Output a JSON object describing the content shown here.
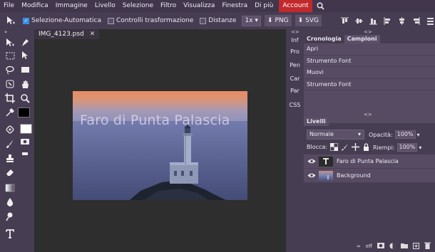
{
  "menubar": {
    "items": [
      "File",
      "Modifica",
      "Immagine",
      "Livello",
      "Selezione",
      "Filtro",
      "Visualizza",
      "Finestra",
      "Di più"
    ],
    "account": "Account",
    "search_icon": "search-icon"
  },
  "options": {
    "auto_select": "Selezione-Automatica",
    "transform_controls": "Controlli trasformazione",
    "distances": "Distanze",
    "zoom": "1x",
    "png": "PNG",
    "svg": "SVG"
  },
  "document": {
    "tab_name": "IMG_4123.psd",
    "close": "✕",
    "overlay_text": "Faro di Punta Palascia"
  },
  "minitabs": [
    "Inf",
    "Pro",
    "Pen",
    "Car",
    "Par",
    "CSS"
  ],
  "history_panel": {
    "tabs": [
      "Cronologia",
      "Campioni"
    ],
    "items": [
      "Apri",
      "Strumento Font",
      "Muovi",
      "Strumento Font"
    ]
  },
  "layers_panel": {
    "title": "Livelli",
    "blend_mode": "Normale",
    "opacity_label": "Opacità:",
    "opacity_value": "100%",
    "lock_label": "Blocca:",
    "fill_label": "Riempi:",
    "fill_value": "100%",
    "layers": [
      {
        "name": "Faro di Punta Palascia",
        "type": "text"
      },
      {
        "name": "Background",
        "type": "image"
      }
    ],
    "bottom_icons": [
      "link-icon",
      "effects-icon",
      "mask-icon",
      "adjustment-icon",
      "folder-icon",
      "new-layer-icon",
      "delete-icon"
    ],
    "bottom_labels": {
      "link": "∞",
      "fx": "eff"
    }
  },
  "colors": {
    "account": "#c2292c",
    "checkbox_on": "#3a8ee6"
  }
}
